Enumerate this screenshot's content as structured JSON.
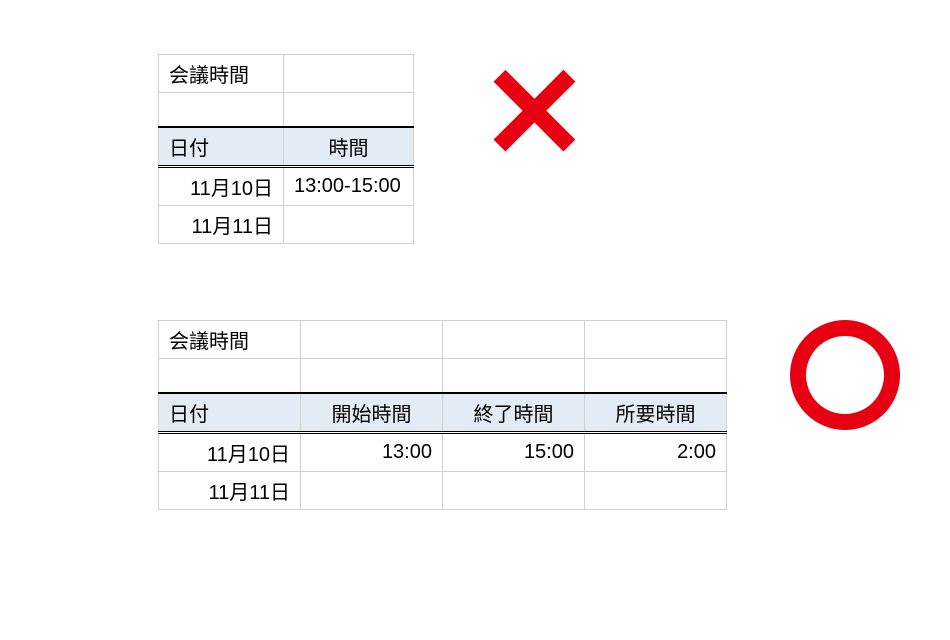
{
  "bad_example": {
    "title": "会議時間",
    "headers": {
      "date": "日付",
      "time": "時間"
    },
    "rows": [
      {
        "date": "11月10日",
        "time": "13:00-15:00"
      },
      {
        "date": "11月11日",
        "time": ""
      }
    ]
  },
  "good_example": {
    "title": "会議時間",
    "headers": {
      "date": "日付",
      "start": "開始時間",
      "end": "終了時間",
      "duration": "所要時間"
    },
    "rows": [
      {
        "date": "11月10日",
        "start": "13:00",
        "end": "15:00",
        "duration": "2:00"
      },
      {
        "date": "11月11日",
        "start": "",
        "end": "",
        "duration": ""
      }
    ]
  },
  "icons": {
    "bad": "cross",
    "good": "circle"
  },
  "colors": {
    "accent": "#e60012",
    "header_bg": "#e3ecf5",
    "border": "#d0d0d0"
  }
}
